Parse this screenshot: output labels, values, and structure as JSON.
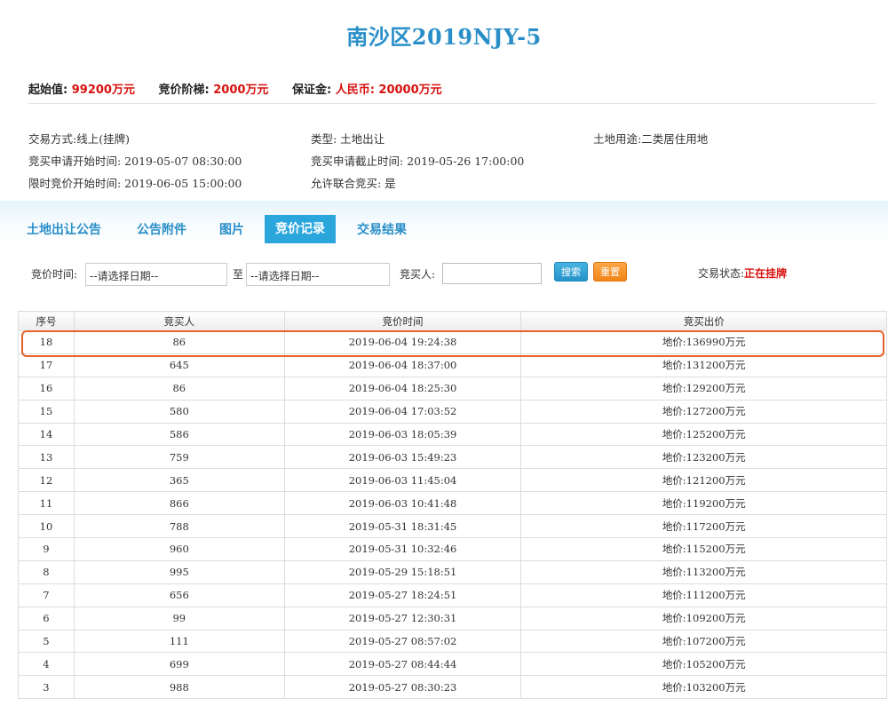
{
  "title": "南沙区2019NJY-5",
  "prices": {
    "start_label": "起始值:",
    "start_value": "99200万元",
    "step_label": "竞价阶梯:",
    "step_value": "2000万元",
    "deposit_label": "保证金:",
    "deposit_value": "人民币: 20000万元"
  },
  "info": {
    "trade_mode": "交易方式:线上(挂牌)",
    "type": "类型: 土地出让",
    "land_use": "土地用途:二类居住用地",
    "apply_start": "竞买申请开始时间:  2019-05-07 08:30:00",
    "apply_end": "竞买申请截止时间: 2019-05-26 17:00:00",
    "bid_start": "限时竞价开始时间: 2019-06-05 15:00:00",
    "joint": "允许联合竞买: 是"
  },
  "tabs": [
    {
      "label": "土地出让公告"
    },
    {
      "label": "公告附件"
    },
    {
      "label": "图片"
    },
    {
      "label": "竞价记录"
    },
    {
      "label": "交易结果"
    }
  ],
  "filter": {
    "time_label": "竞价时间:",
    "date_placeholder": "--请选择日期--",
    "to_label": "至",
    "bidder_label": "竞买人:",
    "search_label": "搜索",
    "reset_label": "重置",
    "status_label": "交易状态:",
    "status_value": "正在挂牌"
  },
  "table": {
    "headers": [
      "序号",
      "竞买人",
      "竞价时间",
      "竞买出价"
    ],
    "rows": [
      [
        "18",
        "86",
        "2019-06-04 19:24:38",
        "地价:136990万元"
      ],
      [
        "17",
        "645",
        "2019-06-04 18:37:00",
        "地价:131200万元"
      ],
      [
        "16",
        "86",
        "2019-06-04 18:25:30",
        "地价:129200万元"
      ],
      [
        "15",
        "580",
        "2019-06-04 17:03:52",
        "地价:127200万元"
      ],
      [
        "14",
        "586",
        "2019-06-03 18:05:39",
        "地价:125200万元"
      ],
      [
        "13",
        "759",
        "2019-06-03 15:49:23",
        "地价:123200万元"
      ],
      [
        "12",
        "365",
        "2019-06-03 11:45:04",
        "地价:121200万元"
      ],
      [
        "11",
        "866",
        "2019-06-03 10:41:48",
        "地价:119200万元"
      ],
      [
        "10",
        "788",
        "2019-05-31 18:31:45",
        "地价:117200万元"
      ],
      [
        "9",
        "960",
        "2019-05-31 10:32:46",
        "地价:115200万元"
      ],
      [
        "8",
        "995",
        "2019-05-29 15:18:51",
        "地价:113200万元"
      ],
      [
        "7",
        "656",
        "2019-05-27 18:24:51",
        "地价:111200万元"
      ],
      [
        "6",
        "99",
        "2019-05-27 12:30:31",
        "地价:109200万元"
      ],
      [
        "5",
        "111",
        "2019-05-27 08:57:02",
        "地价:107200万元"
      ],
      [
        "4",
        "699",
        "2019-05-27 08:44:44",
        "地价:105200万元"
      ],
      [
        "3",
        "988",
        "2019-05-27 08:30:23",
        "地价:103200万元"
      ]
    ]
  }
}
